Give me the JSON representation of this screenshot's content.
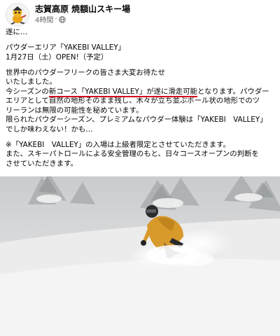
{
  "header": {
    "avatar_icon": "mascot-avatar-icon",
    "page_name": "志賀高原 焼額山スキー場",
    "time": "4時間",
    "separator": "·",
    "audience_icon": "globe-icon"
  },
  "post": {
    "p1": "遂に…",
    "p2_l1": "パウダーエリア「YAKEBI VALLEY」",
    "p2_l2": "1月27日（土）OPEN!（予定）",
    "p3_l1": "世界中のパウダーフリークの皆さま大変お待たせ",
    "p3_l2": "いたしました。",
    "p3_l3_pre": "今シーズンの",
    "p3_l3_hl": "新コース「YAKEBI VALLEY」が遂に滑走可能",
    "p3_l3_post": "となります。パウダー",
    "p3_l4": "エリアとして自然の地形そのまま残し、木々が立ち並ぶポール状の地形でのツ",
    "p3_l5": "リーランは無限の可能性を秘めています。",
    "p3_l6": "限られたパウダーシーズン、プレミアムなパウダー体験は「YAKEBI　VALLEY」",
    "p3_l7": "でしか味わえない！かも…",
    "p4_l1": "※「YAKEBI　VALLEY」の入場は上級者限定とさせていただきます。",
    "p4_l2": "また、スキーパトロールによる安全管理のもと、日々コースオープンの判断を",
    "p4_l3": "させていただきます。"
  },
  "photo": {
    "subject": "snowboarder in yellow jacket riding deep powder among snow-covered trees"
  },
  "colors": {
    "underline": "#d4001c",
    "meta_text": "#65676b",
    "jacket": "#d89a2a"
  }
}
